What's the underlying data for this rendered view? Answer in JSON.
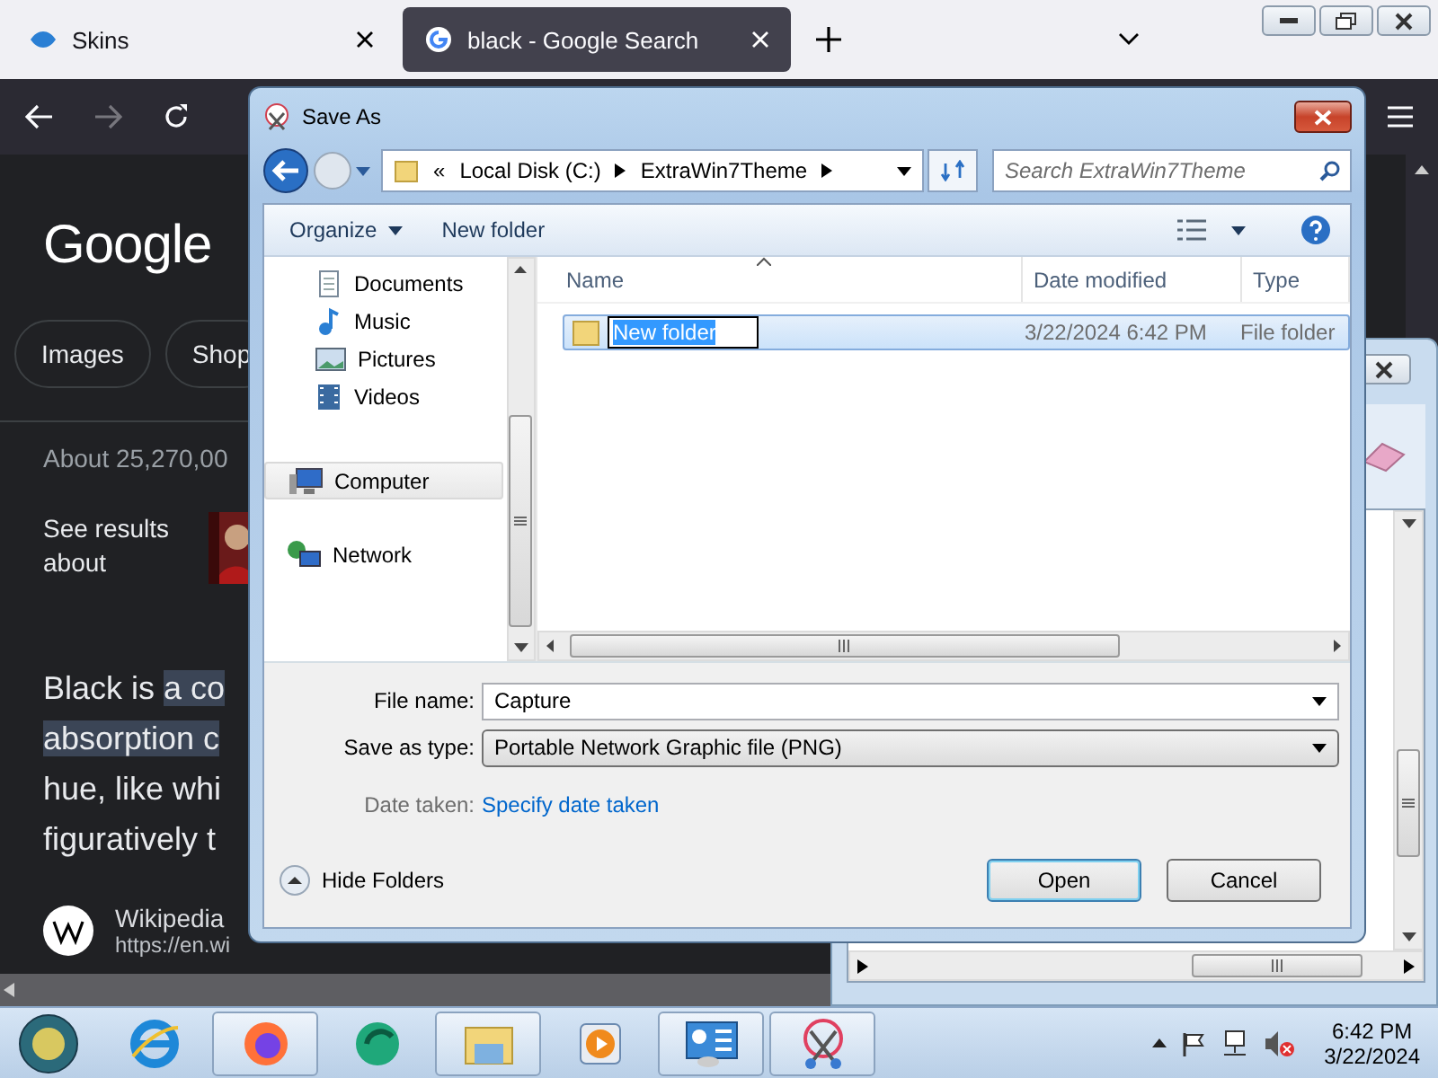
{
  "browser": {
    "tabs": [
      {
        "label": "Skins",
        "selected": false
      },
      {
        "label": "black - Google Search",
        "selected": true
      }
    ],
    "page": {
      "logo": "Google",
      "chips": [
        "Images",
        "Shop"
      ],
      "result_count": "About 25,270,00",
      "see_results": "See results about",
      "snippet": [
        [
          {
            "text": "Black is ",
            "highlighted": false
          },
          {
            "text": "a co",
            "highlighted": true
          }
        ],
        [
          {
            "text": "absorption c",
            "highlighted": true
          }
        ],
        [
          {
            "text": "hue, like whi",
            "highlighted": false
          }
        ],
        [
          {
            "text": "figuratively t",
            "highlighted": false
          }
        ]
      ],
      "source_name": "Wikipedia",
      "source_url": "https://en.wi"
    }
  },
  "dialog": {
    "title": "Save As",
    "overflow_mark": "«",
    "breadcrumb": [
      "Local Disk (C:)",
      "ExtraWin7Theme"
    ],
    "search": {
      "placeholder": "Search ExtraWin7Theme"
    },
    "toolbar": [
      {
        "label": "Organize",
        "menu": true
      },
      {
        "label": "New folder",
        "menu": false
      }
    ],
    "nav_items": [
      {
        "label": "Documents",
        "kind": "documents",
        "selected": false
      },
      {
        "label": "Music",
        "kind": "music",
        "selected": false
      },
      {
        "label": "Pictures",
        "kind": "pictures",
        "selected": false
      },
      {
        "label": "Videos",
        "kind": "videos",
        "selected": false
      },
      {
        "label": "Computer",
        "kind": "computer",
        "selected": true
      },
      {
        "label": "Network",
        "kind": "network",
        "selected": false
      }
    ],
    "columns": [
      {
        "label": "Name",
        "sorted": true
      },
      {
        "label": "Date modified",
        "sorted": false
      },
      {
        "label": "Type",
        "sorted": false
      }
    ],
    "rows": [
      {
        "name": "New folder",
        "date": "3/22/2024 6:42 PM",
        "type": "File folder",
        "selected": true,
        "renaming": true
      }
    ],
    "file_name_label": "File name:",
    "file_name": "Capture",
    "type_label": "Save as type:",
    "save_as_type": "Portable Network Graphic file (PNG)",
    "date_taken_label": "Date taken:",
    "date_taken_link": "Specify date taken",
    "hide_folders": "Hide Folders",
    "buttons": [
      {
        "label": "Open",
        "default": true
      },
      {
        "label": "Cancel",
        "default": false
      }
    ]
  },
  "taskbar": {
    "apps": [
      {
        "active": false
      },
      {
        "active": true
      },
      {
        "active": false
      },
      {
        "active": true
      },
      {
        "active": false
      },
      {
        "active": true
      },
      {
        "active": true
      }
    ],
    "time": "6:42 PM",
    "date": "3/22/2024"
  }
}
